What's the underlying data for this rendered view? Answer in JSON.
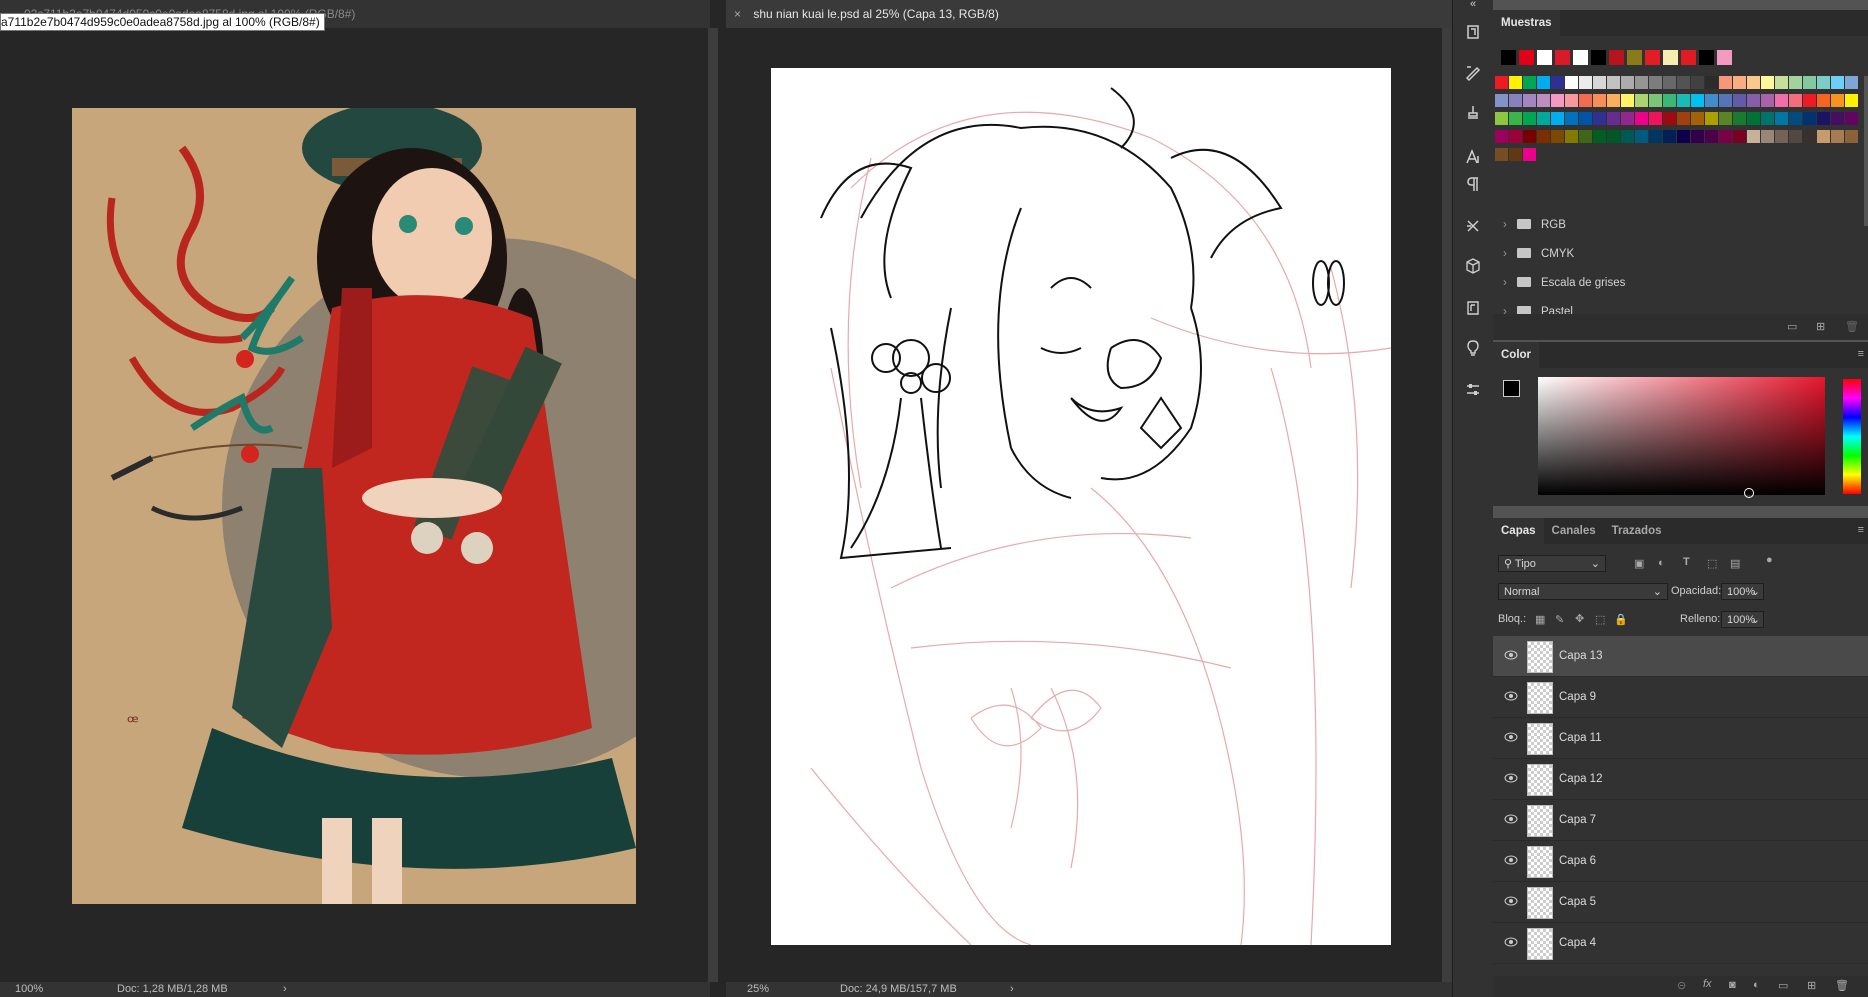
{
  "left_doc": {
    "tab_title": "02c711b2e7b0474d959c0e0adea8758d.jpg al 100% (RGB/8#)",
    "tooltip": "a711b2e7b0474d959c0e0adea8758d.jpg al 100% (RGB/8#)",
    "zoom": "100%",
    "doc_info": "Doc: 1,28 MB/1,28 MB",
    "arrow": "›"
  },
  "right_doc": {
    "close": "×",
    "tab_title": "shu nian kuai le.psd al 25% (Capa 13, RGB/8)",
    "zoom": "25%",
    "doc_info": "Doc: 24,9 MB/157,7 MB",
    "arrow": "›"
  },
  "toolbar": {
    "collapse": "«",
    "tools": [
      "frame-adjust-icon",
      "brush-preset-icon",
      "stamp-clone-icon",
      "character-text-icon",
      "paragraph-icon",
      "tool-presets-icon",
      "3d-cube-icon",
      "glyphs-panel-icon",
      "learn-bulb-icon",
      "properties-sliders-icon"
    ]
  },
  "swatches": {
    "title": "Muestras",
    "recent": [
      "#000000",
      "#e00018",
      "#ffffff",
      "#d81a2a",
      "#ffffff",
      "#000000",
      "#b8141e",
      "#8a7a1a",
      "#e31c25",
      "#f5eeb0",
      "#e11b22",
      "#000000",
      "#f49ac1"
    ],
    "grid_rows": [
      [
        "#ed1c24",
        "#fff200",
        "#00a651",
        "#00aeef",
        "#2e3192",
        "#ffffff",
        "#ebebeb",
        "#d7d7d7",
        "#c2c2c2",
        "#acacac",
        "#959595",
        "#7d7d7d",
        "#686868",
        "#535353",
        "#414141",
        "#2c2c2c",
        "#f7977a",
        "#f9ad81",
        "#fdc68a",
        "#fff79a",
        "#c4df9b",
        "#a3d39c",
        "#82ca9d",
        "#7bcdc8",
        "#6ecff6",
        "#7ea7d8"
      ],
      [
        "#8393ca",
        "#8781bd",
        "#a187be",
        "#bc8dbf",
        "#f49ac2",
        "#f6989d",
        "#f26c4f",
        "#f68e55",
        "#fbaf5c",
        "#fff467",
        "#acd372",
        "#7cc576",
        "#3bb878",
        "#1abbb4",
        "#00bff3",
        "#438cca",
        "#5574b9",
        "#605ca8",
        "#855fa8",
        "#a763a8",
        "#f06ea9",
        "#f26d7d",
        "#ed1c24",
        "#f26522",
        "#f7941d",
        "#fff200"
      ],
      [
        "#8dc73f",
        "#39b54a",
        "#00a651",
        "#00a99d",
        "#00aeef",
        "#0072bc",
        "#0054a6",
        "#2e3192",
        "#662d91",
        "#92278f",
        "#ec008c",
        "#ed145b",
        "#9e0b0f",
        "#a0410d",
        "#a36209",
        "#aba000",
        "#598527",
        "#197b30",
        "#007236",
        "#00746b",
        "#0076a3",
        "#004b80",
        "#003471",
        "#1b1464",
        "#440e62",
        "#630460"
      ],
      [
        "#9e005d",
        "#9e0039",
        "#790000",
        "#7b2e00",
        "#7d4900",
        "#827b00",
        "#406618",
        "#005e20",
        "#005826",
        "#005952",
        "#005b7f",
        "#003663",
        "#002157",
        "#0d004c",
        "#32004b",
        "#4b0049",
        "#7b0046",
        "#7a0026",
        "#c7b299",
        "#998675",
        "#736357",
        "#534741",
        "#37302d",
        "#c69c6d",
        "#a67c52",
        "#8c6239"
      ],
      [
        "#754c24",
        "#603913",
        "#ec008c"
      ]
    ],
    "groups": [
      "RGB",
      "CMYK",
      "Escala de grises",
      "Pastel"
    ],
    "footer_icons": [
      "new-group-icon",
      "new-swatch-icon",
      "delete-swatch-icon"
    ]
  },
  "color": {
    "title": "Color",
    "foreground": "#000000",
    "background": "#000000"
  },
  "layers": {
    "tabs": [
      "Capas",
      "Canales",
      "Trazados"
    ],
    "filter_kind": "Tipo",
    "blend_mode": "Normal",
    "opacity_label": "Opacidad:",
    "opacity": "100%",
    "lock_label": "Bloq.:",
    "fill_label": "Relleno:",
    "fill": "100%",
    "items": [
      "Capa 13",
      "Capa 9",
      "Capa 11",
      "Capa 12",
      "Capa 7",
      "Capa 6",
      "Capa 5",
      "Capa 4"
    ],
    "selected": "Capa 13",
    "footer_icons": [
      "link-icon",
      "fx-icon",
      "mask-icon",
      "adjustment-icon",
      "group-icon",
      "new-layer-icon",
      "trash-icon"
    ]
  },
  "accent": "#4a4a4a"
}
